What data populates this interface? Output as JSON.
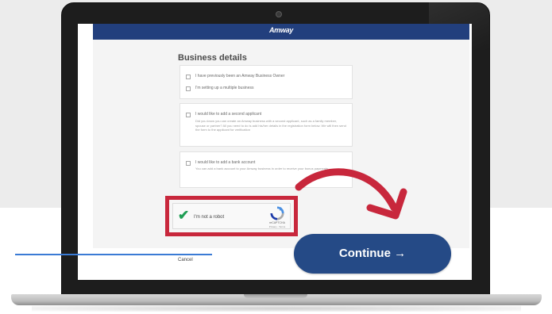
{
  "header": {
    "logo": "Amway"
  },
  "form": {
    "section_title": "Business details",
    "options": [
      {
        "label": "I have previously been an Amway Business Owner"
      },
      {
        "label": "I'm setting up a multiple business"
      },
      {
        "label": "I would like to add a second applicant",
        "description": "Did you know you can create an Amway business with a second applicant, such as a family member, spouse or partner? All you need to do is add his/her details in the registration form below. We will then send the form to the applicant for verification"
      },
      {
        "label": "I would like to add a bank account",
        "description": "You can add a bank account to your Amway business in order to receive your bonus payments"
      }
    ]
  },
  "captcha": {
    "label": "I'm not a robot",
    "brand": "reCAPTCHA",
    "terms": "Privacy - Terms"
  },
  "actions": {
    "cancel_label": "Cancel",
    "continue_label": "Continue →"
  },
  "colors": {
    "brand_blue": "#223f7d",
    "continue_button": "#254a86",
    "highlight_red": "#c8273c",
    "check_green": "#1f9e54"
  }
}
